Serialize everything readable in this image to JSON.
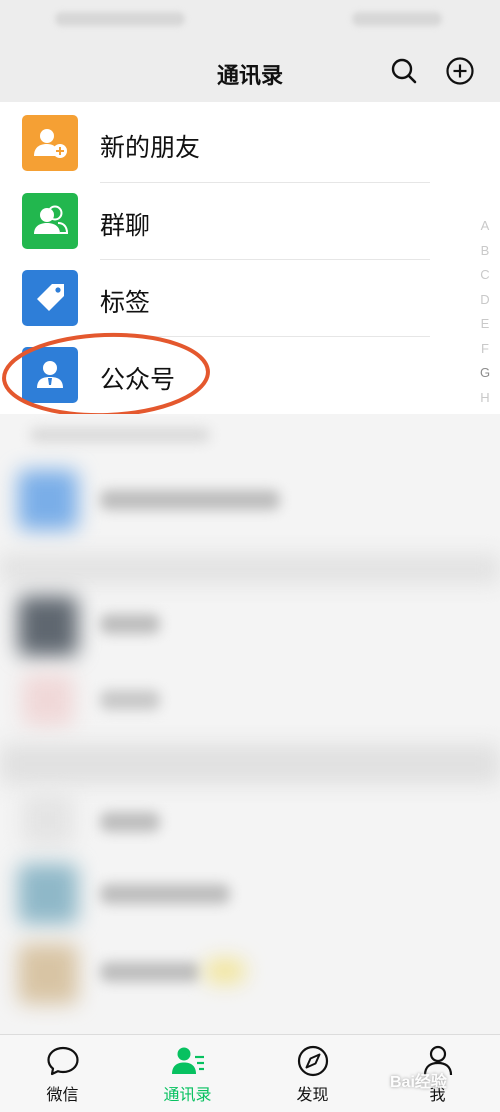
{
  "header": {
    "title": "通讯录"
  },
  "menu": {
    "items": [
      {
        "label": "新的朋友",
        "icon": "new-friend-icon",
        "color": "#f5a034"
      },
      {
        "label": "群聊",
        "icon": "group-chat-icon",
        "color": "#22b74e"
      },
      {
        "label": "标签",
        "icon": "tag-icon",
        "color": "#2e7ed8"
      },
      {
        "label": "公众号",
        "icon": "official-account-icon",
        "color": "#2e7ed8"
      }
    ]
  },
  "annotation": {
    "color": "#e4582e"
  },
  "index": [
    "A",
    "B",
    "C",
    "D",
    "E",
    "F",
    "G",
    "H"
  ],
  "tabs": [
    {
      "label": "微信",
      "icon": "chat-bubble-icon"
    },
    {
      "label": "通讯录",
      "icon": "contacts-icon",
      "active": true
    },
    {
      "label": "发现",
      "icon": "compass-icon"
    },
    {
      "label": "我",
      "icon": "person-icon"
    }
  ],
  "accent_color": "#07c160",
  "watermark": "Bai经验"
}
